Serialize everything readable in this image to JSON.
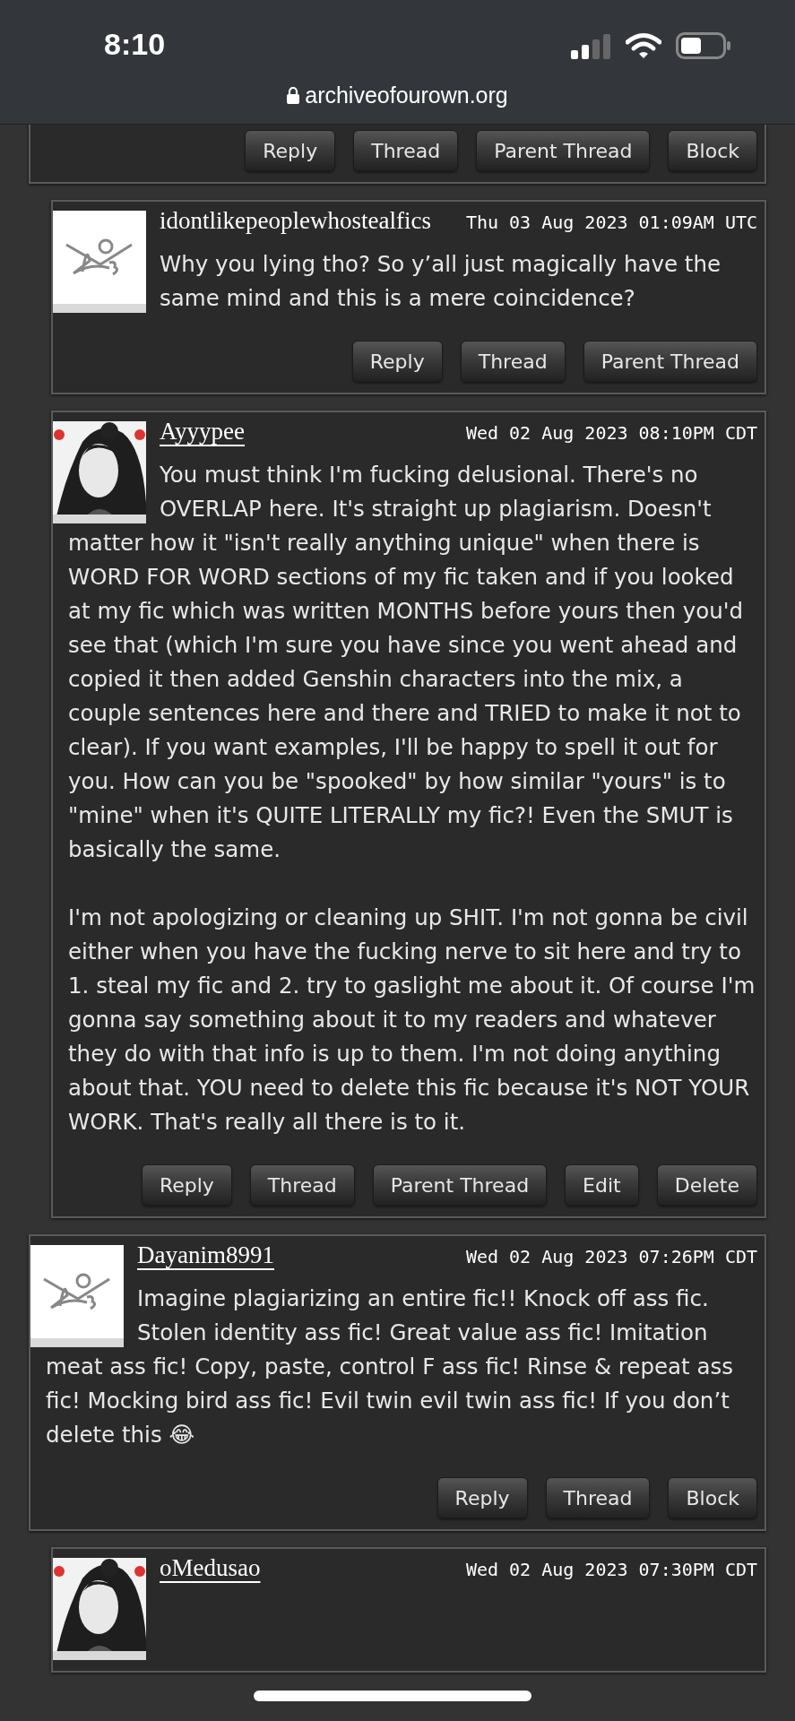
{
  "status_bar": {
    "time": "8:10"
  },
  "address_bar": {
    "url": "archiveofourown.org"
  },
  "comments": [
    {
      "children": [
        {
          "buttons": [
            "Reply",
            "Thread",
            "Parent Thread",
            "Block"
          ],
          "children": [
            {
              "username": "idontlikepeoplewhostealfics",
              "linked": false,
              "date": "Thu 03 Aug 2023 01:09AM UTC",
              "avatar": {
                "kind": "default"
              },
              "beside_avatar": "Why you lying tho? So y’all just magically have the same mind and this is a mere coincidence?",
              "buttons": [
                "Reply",
                "Thread",
                "Parent Thread"
              ]
            },
            {
              "username": "Ayyypee",
              "linked": true,
              "date": "Wed 02 Aug 2023 08:10PM CDT",
              "avatar": {
                "kind": "picture"
              },
              "beside_avatar": "You must think I'm fucking delusional. There's no OVERLAP here. It's straight up plagiarism. Doesn't",
              "body": [
                "matter how it \"isn't really anything unique\" when there is WORD FOR WORD sections of my fic taken and if you looked at my fic which was written MONTHS before yours then you'd see that (which I'm sure you have since you went ahead and copied it then added Genshin characters into the mix, a couple sentences here and there and TRIED to make it not to clear). If you want examples, I'll be happy to spell it out for you. How can you be \"spooked\" by how similar \"yours\" is to \"mine\" when it's QUITE LITERALLY my fic?! Even the SMUT is basically the same.",
                "I'm not apologizing or cleaning up SHIT. I'm not gonna be civil either when you have the fucking nerve to sit here and try to 1. steal my fic and 2. try to gaslight me about it. Of course I'm gonna say something about it to my readers and whatever they do with that info is up to them. I'm not doing anything about that. YOU need to delete this fic because it's NOT YOUR WORK. That's really all there is to it."
              ],
              "buttons": [
                "Reply",
                "Thread",
                "Parent Thread",
                "Edit",
                "Delete"
              ]
            }
          ]
        }
      ]
    },
    {
      "username": "Dayanim8991",
      "linked": true,
      "date": "Wed 02 Aug 2023 07:26PM CDT",
      "avatar": {
        "kind": "default"
      },
      "beside_avatar": "Imagine plagiarizing an entire fic!! Knock off ass fic. Stolen identity ass fic! Great value ass fic! Imitation",
      "body": [
        "meat ass fic! Copy, paste, control F ass fic! Rinse & repeat ass fic! Mocking bird ass fic! Evil twin evil twin ass fic! If you don’t delete this 😂"
      ],
      "buttons": [
        "Reply",
        "Thread",
        "Block"
      ],
      "children": [
        {
          "username": "oMedusao",
          "linked": true,
          "date": "Wed 02 Aug 2023 07:30PM CDT",
          "avatar": {
            "kind": "picture"
          }
        }
      ]
    }
  ]
}
